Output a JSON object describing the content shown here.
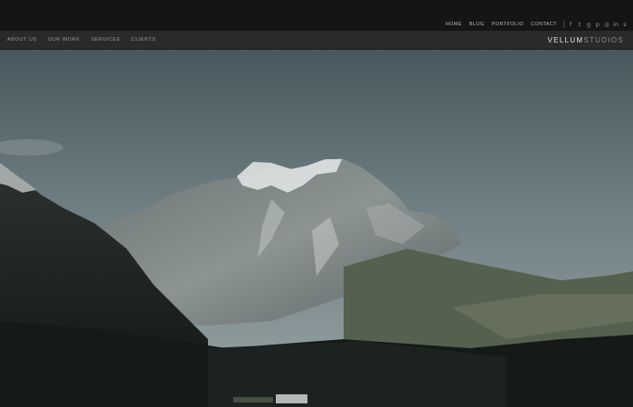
{
  "top_links": [
    "HOME",
    "BLOG",
    "PORTFOLIO",
    "CONTACT"
  ],
  "socials": [
    {
      "icon": "facebook-icon",
      "glyph": "f"
    },
    {
      "icon": "twitter-icon",
      "glyph": "t"
    },
    {
      "icon": "google-plus-icon",
      "glyph": "g"
    },
    {
      "icon": "pinterest-icon",
      "glyph": "p"
    },
    {
      "icon": "dribbble-icon",
      "glyph": "◎"
    },
    {
      "icon": "linkedin-icon",
      "glyph": "in"
    },
    {
      "icon": "skype-icon",
      "glyph": "s"
    }
  ],
  "nav": [
    "ABOUT US",
    "OUR WORK",
    "SERVICES",
    "CLIENTS"
  ],
  "logo": {
    "bold": "VELLUM",
    "thin": "STUDIOS"
  },
  "colors": {
    "topbar": "#151515",
    "navbar": "#2a2a2b",
    "sky_top": "#4b5a60",
    "sky_bottom": "#8d9a9c"
  }
}
